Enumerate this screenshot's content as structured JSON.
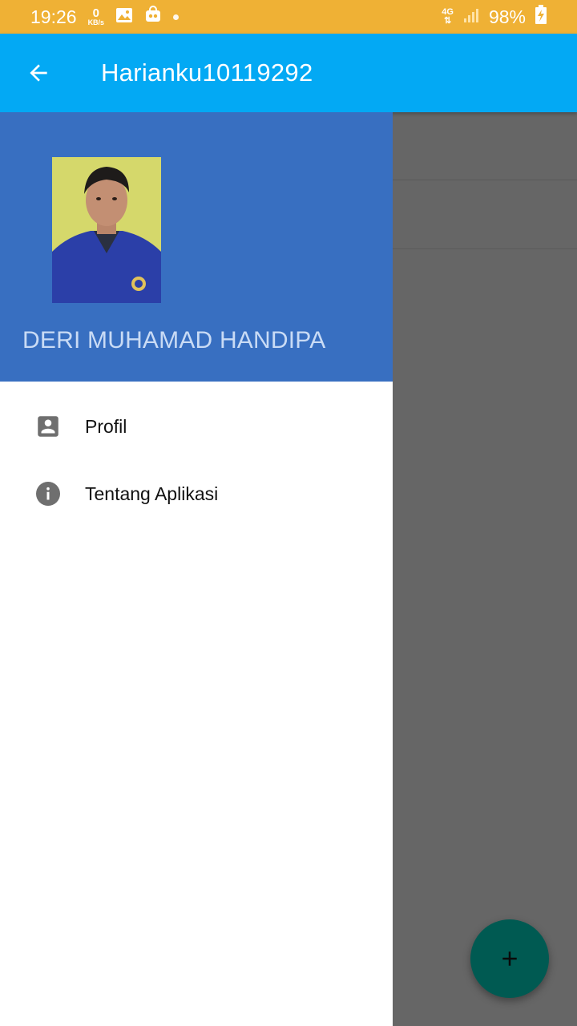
{
  "status_bar": {
    "time": "19:26",
    "speed_value": "0",
    "speed_unit": "KB/s",
    "network": "4G",
    "battery": "98%"
  },
  "app_bar": {
    "title": "Harianku10119292",
    "back_icon": "arrow-back-icon"
  },
  "drawer": {
    "user_name": "DERI MUHAMAD HANDIPA",
    "header_color": "#386fc1",
    "items": [
      {
        "label": "Profil",
        "icon": "account-box-icon"
      },
      {
        "label": "Tentang Aplikasi",
        "icon": "info-icon"
      }
    ]
  },
  "fab": {
    "icon": "add-icon",
    "color": "#005a52"
  },
  "colors": {
    "status_bar": "#efb135",
    "app_bar": "#03a9f4",
    "scrim": "#666666"
  }
}
